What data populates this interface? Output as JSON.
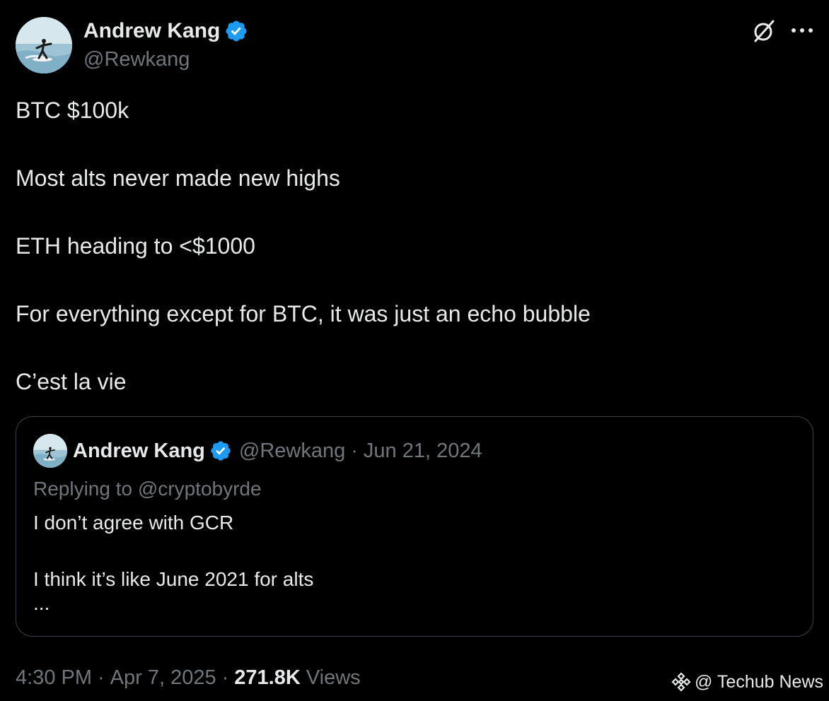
{
  "author": {
    "name": "Andrew Kang",
    "handle": "@Rewkang"
  },
  "icons": {
    "verified": "verified-badge-icon",
    "grok": "grok-slash-icon",
    "more": "more-dots-icon",
    "watermark": "binance-square-icon"
  },
  "colors": {
    "background": "#000000",
    "text": "#e7e9ea",
    "muted": "#71767b",
    "verified": "#1d9bf0",
    "border": "#3b4046"
  },
  "tweet": {
    "lines": [
      "BTC $100k",
      "Most alts never made new highs",
      "ETH heading to <$1000",
      "For everything except for BTC, it was just an echo bubble",
      "C’est la vie"
    ]
  },
  "quote": {
    "name": "Andrew Kang",
    "handle": "@Rewkang",
    "separator": "·",
    "date": "Jun 21, 2024",
    "replying": "Replying to @cryptobyrde",
    "lines": [
      "I don’t agree with GCR",
      "I think it’s like June 2021 for alts",
      "..."
    ]
  },
  "meta": {
    "time": "4:30 PM",
    "separator": "·",
    "date": "Apr 7, 2025",
    "views_count": "271.8K",
    "views_label": "Views"
  },
  "watermark": {
    "text": "@ Techub News"
  }
}
